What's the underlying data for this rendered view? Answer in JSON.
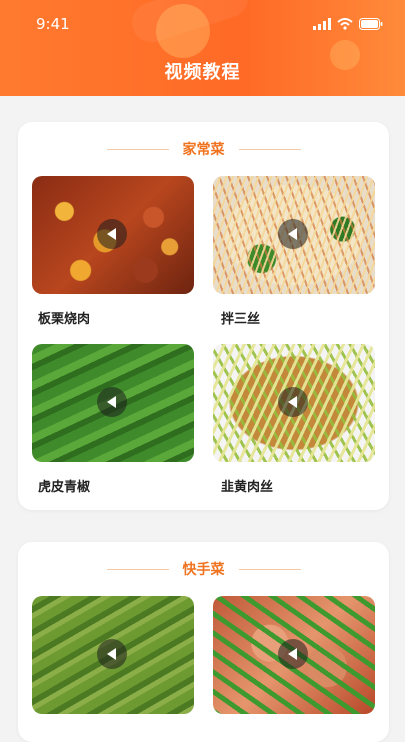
{
  "status_bar": {
    "time": "9:41"
  },
  "header": {
    "title": "视频教程",
    "accent": "#ff6a26"
  },
  "sections": [
    {
      "title": "家常菜",
      "dishes": [
        {
          "name": "板栗烧肉",
          "icon": "play-icon"
        },
        {
          "name": "拌三丝",
          "icon": "play-icon"
        },
        {
          "name": "虎皮青椒",
          "icon": "play-icon"
        },
        {
          "name": "韭黄肉丝",
          "icon": "play-icon"
        }
      ]
    },
    {
      "title": "快手菜",
      "dishes": [
        {
          "icon": "play-icon"
        },
        {
          "icon": "play-icon"
        }
      ]
    }
  ]
}
